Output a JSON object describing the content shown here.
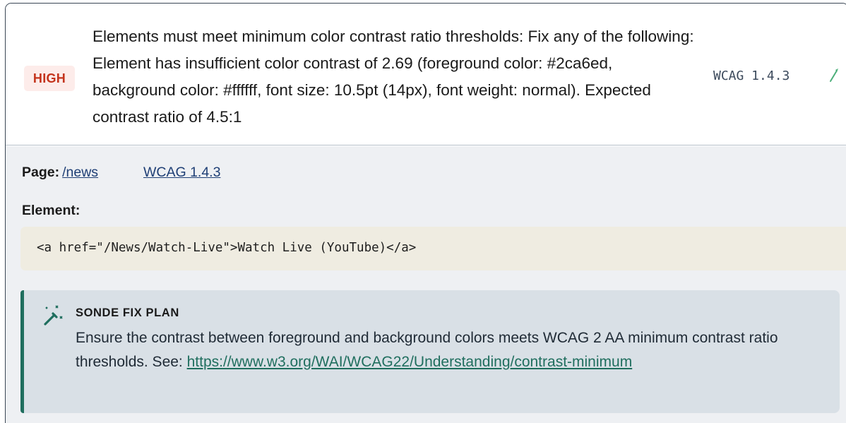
{
  "issue": {
    "severity": "HIGH",
    "title": "Elements must meet minimum color contrast ratio thresholds: Fix any of the following: Element has insufficient color contrast of 2.69 (foreground color: #2ca6ed, background color: #ffffff, font size: 10.5pt (14px), font weight: normal). Expected contrast ratio of 4.5:1",
    "wcag_tag": "WCAG 1.4.3"
  },
  "meta": {
    "page_label": "Page:",
    "page_link": "/news",
    "wcag_link": "WCAG 1.4.3"
  },
  "element": {
    "label": "Element:",
    "code": "<a href=\"/News/Watch-Live\">Watch Live (YouTube)</a>"
  },
  "fix_plan": {
    "title": "SONDE FIX PLAN",
    "text": "Ensure the contrast between foreground and background colors meets WCAG 2 AA minimum contrast ratio thresholds. See: ",
    "link": "https://www.w3.org/WAI/WCAG22/Understanding/contrast-minimum"
  },
  "colors": {
    "severity_bg": "#fdecea",
    "severity_text": "#c4341c",
    "accent": "#1f6e5e",
    "link": "#1f3f75"
  },
  "icons": {
    "header_action": "magic-wand-icon",
    "fix_plan": "magic-wand-sparkle-icon"
  }
}
